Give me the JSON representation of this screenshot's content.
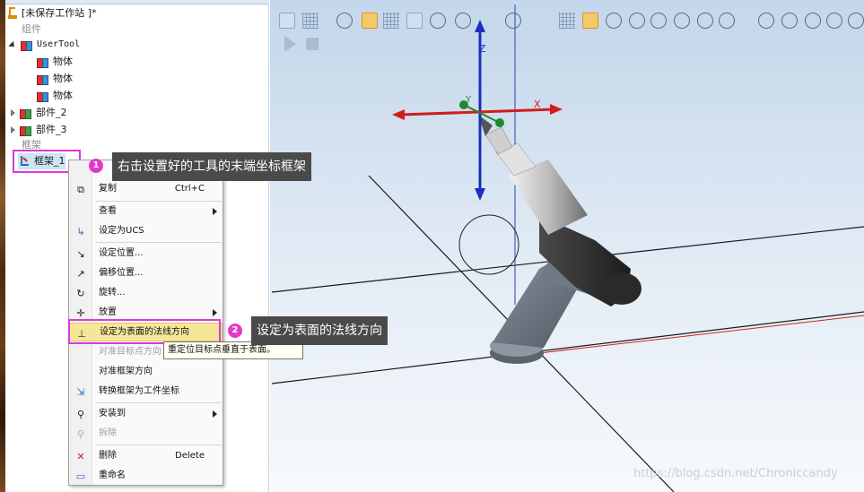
{
  "tree": {
    "station_title": "[未保存工作站 ]*",
    "components_header": "组件",
    "usertool_label": "UserTool",
    "body_items": [
      "物体",
      "物体",
      "物体"
    ],
    "part2_label": "部件_2",
    "part3_label": "部件_3",
    "frames_header": "框架",
    "frame1_label": "框架_1"
  },
  "context_menu": {
    "items": [
      {
        "label": "复制",
        "shortcut": "Ctrl+C",
        "icon": "copy-icon"
      },
      {
        "label": "查看",
        "submenu": true
      },
      {
        "label": "设定为UCS",
        "icon": "ucs-icon"
      },
      {
        "label": "设定位置...",
        "icon": "arrow-icon"
      },
      {
        "label": "偏移位置...",
        "icon": "offset-icon"
      },
      {
        "label": "旋转...",
        "icon": "rotate-icon"
      },
      {
        "label": "放置",
        "submenu": true,
        "icon": "place-icon"
      },
      {
        "label": "设定为表面的法线方向",
        "icon": "normal-icon",
        "selected": true
      },
      {
        "label": "对准目标点方向",
        "disabled": true
      },
      {
        "label": "对准框架方向"
      },
      {
        "label": "转换框架为工件坐标",
        "icon": "convert-icon"
      },
      {
        "label": "安装到",
        "submenu": true,
        "icon": "attach-icon"
      },
      {
        "label": "拆除",
        "disabled": true,
        "icon": "detach-icon"
      },
      {
        "label": "删除",
        "shortcut": "Delete",
        "icon": "delete-icon"
      },
      {
        "label": "重命名",
        "icon": "rename-icon"
      }
    ]
  },
  "tooltip": "重定位目标点垂直于表面。",
  "callouts": [
    {
      "number": "1",
      "text": "右击设置好的工具的末端坐标框架"
    },
    {
      "number": "2",
      "text": "设定为表面的法线方向"
    }
  ],
  "viewport": {
    "axis_z": "Z",
    "axis_x": "X",
    "axis_y": "Y"
  },
  "watermark": "https://blog.csdn.net/Chroniccandy",
  "colors": {
    "highlight": "#d83ad8",
    "callout_bg": "#4a4a4a",
    "menu_selected": "#f5e69a",
    "viewport_top": "#c7d9ec",
    "viewport_bottom": "#f6f9fc"
  }
}
